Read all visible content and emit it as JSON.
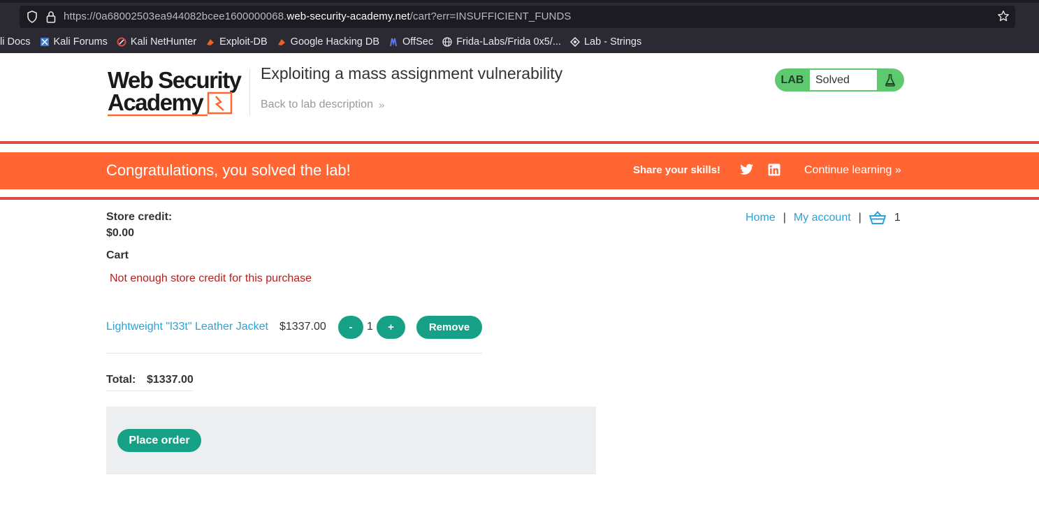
{
  "browser": {
    "url_prefix": "https://0a68002503ea944082bcee1600000068.",
    "url_host": "web-security-academy.net",
    "url_path": "/cart?err=INSUFFICIENT_FUNDS",
    "bookmarks": [
      {
        "label": "li Docs",
        "icon": "kali-docs-icon"
      },
      {
        "label": "Kali Forums",
        "icon": "kali-forums-icon"
      },
      {
        "label": "Kali NetHunter",
        "icon": "kali-nethunter-icon"
      },
      {
        "label": "Exploit-DB",
        "icon": "exploit-db-icon"
      },
      {
        "label": "Google Hacking DB",
        "icon": "google-hacking-db-icon"
      },
      {
        "label": "OffSec",
        "icon": "offsec-icon"
      },
      {
        "label": "Frida-Labs/Frida 0x5/...",
        "icon": "globe-icon"
      },
      {
        "label": "Lab - Strings",
        "icon": "diamond-icon"
      }
    ]
  },
  "header": {
    "logo_line1": "Web Security",
    "logo_line2": "Academy",
    "lab_title": "Exploiting a mass assignment vulnerability",
    "back_link": "Back to lab description",
    "status_lab": "LAB",
    "status_text": "Solved"
  },
  "banner": {
    "congrats": "Congratulations, you solved the lab!",
    "share": "Share your skills!",
    "continue": "Continue learning"
  },
  "nav": {
    "home": "Home",
    "account": "My account",
    "separator": "|",
    "cart_count": "1"
  },
  "store": {
    "credit_label": "Store credit:",
    "credit_value": "$0.00"
  },
  "cart": {
    "title": "Cart",
    "error": "Not enough store credit for this purchase",
    "item_name": "Lightweight \"l33t\" Leather Jacket",
    "item_price": "$1337.00",
    "minus_label": "-",
    "quantity": "1",
    "plus_label": "+",
    "remove_label": "Remove",
    "total_label": "Total:",
    "total_value": "$1337.00",
    "place_order_label": "Place order"
  },
  "colors": {
    "accent": "#ff6633",
    "button": "#16a085",
    "link": "#2aa2d6",
    "error": "#b81d1d",
    "status_green": "#5fc96f"
  }
}
